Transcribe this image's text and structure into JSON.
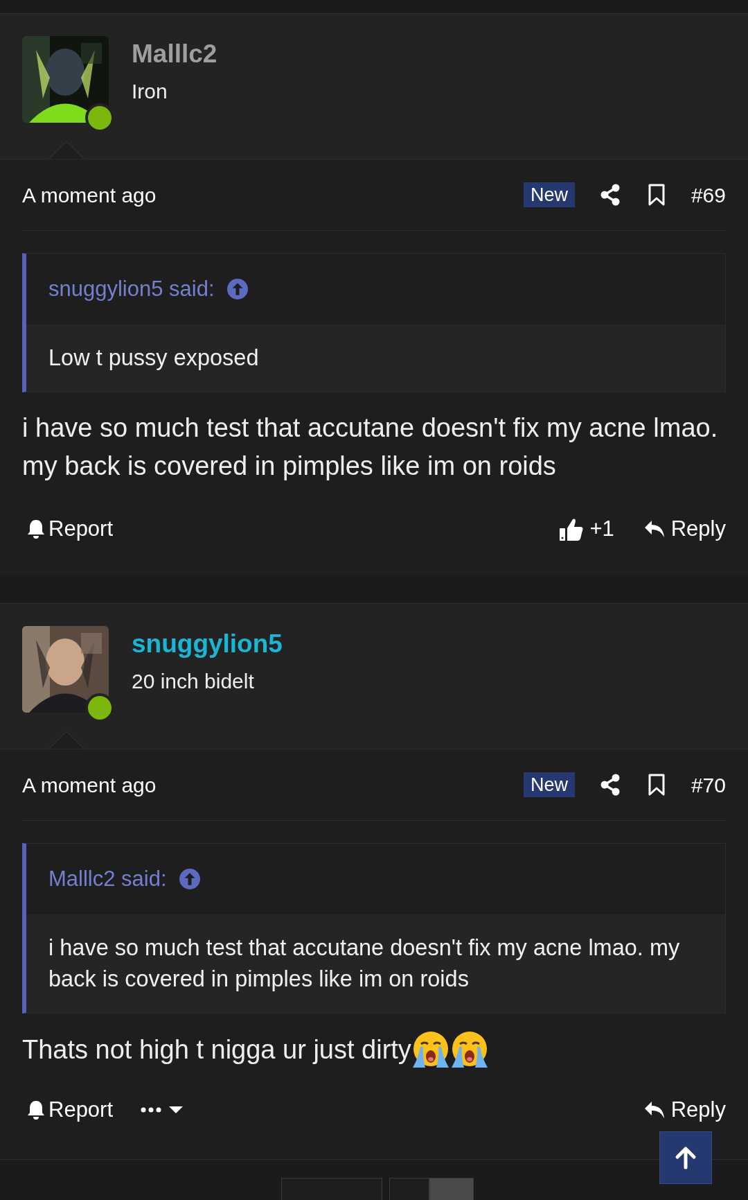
{
  "posts": [
    {
      "author": {
        "name": "Malllc2",
        "color": "#9e9e9e",
        "title": "Iron",
        "online": true
      },
      "time": "A moment ago",
      "badge": "New",
      "number": "#69",
      "quote": {
        "attribution": "snuggylion5 said:",
        "text": "Low t pussy exposed"
      },
      "body": "i have so much test that accutane doesn't fix my acne lmao. my back is covered in pimples like im on roids",
      "report": "Report",
      "likes": "+1",
      "reply": "Reply"
    },
    {
      "author": {
        "name": "snuggylion5",
        "color": "#1ab6d4",
        "title": "20 inch bidelt",
        "online": true
      },
      "time": "A moment ago",
      "badge": "New",
      "number": "#70",
      "quote": {
        "attribution": "Malllc2 said:",
        "text": "i have so much test that accutane doesn't fix my acne lmao. my back is covered in pimples like im on roids"
      },
      "body": "Thats not high t nigga ur just dirty",
      "emojis": [
        {
          "kind": "crying"
        },
        {
          "kind": "crying"
        }
      ],
      "report": "Report",
      "more_menu": true,
      "reply": "Reply"
    }
  ],
  "pagination": [
    {
      "selected": false
    },
    {
      "selected": false
    },
    {
      "selected": true
    }
  ],
  "scroll_top_button": true
}
